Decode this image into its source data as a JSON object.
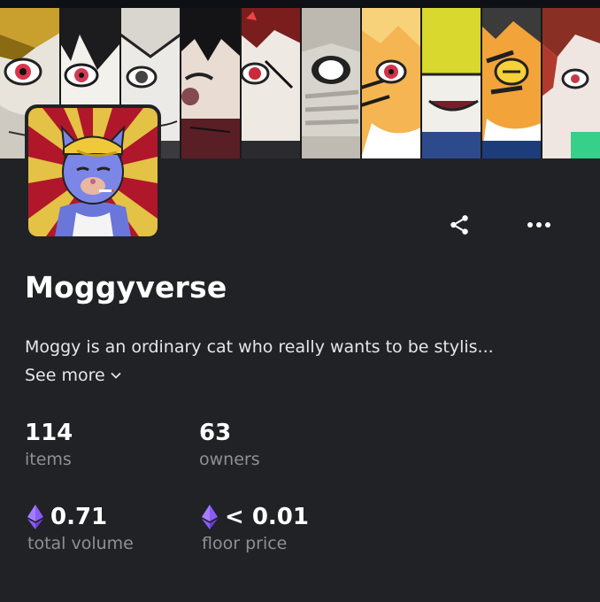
{
  "collection": {
    "name": "Moggyverse",
    "description": "Moggy is an ordinary cat who really wants to be stylis...",
    "see_more_label": "See more"
  },
  "icons": {
    "share": "share-icon",
    "more": "more-icon",
    "expand": "chevron-down-icon",
    "currency": "ethereum-icon"
  },
  "stats": {
    "items": {
      "value": "114",
      "label": "items"
    },
    "owners": {
      "value": "63",
      "label": "owners"
    },
    "total_volume": {
      "value": "0.71",
      "label": "total volume"
    },
    "floor_price": {
      "value": "< 0.01",
      "label": "floor price"
    }
  },
  "colors": {
    "background": "#202225",
    "text_primary": "#ffffff",
    "text_secondary": "#8e9096",
    "ethereum": "#8a5cf5"
  }
}
